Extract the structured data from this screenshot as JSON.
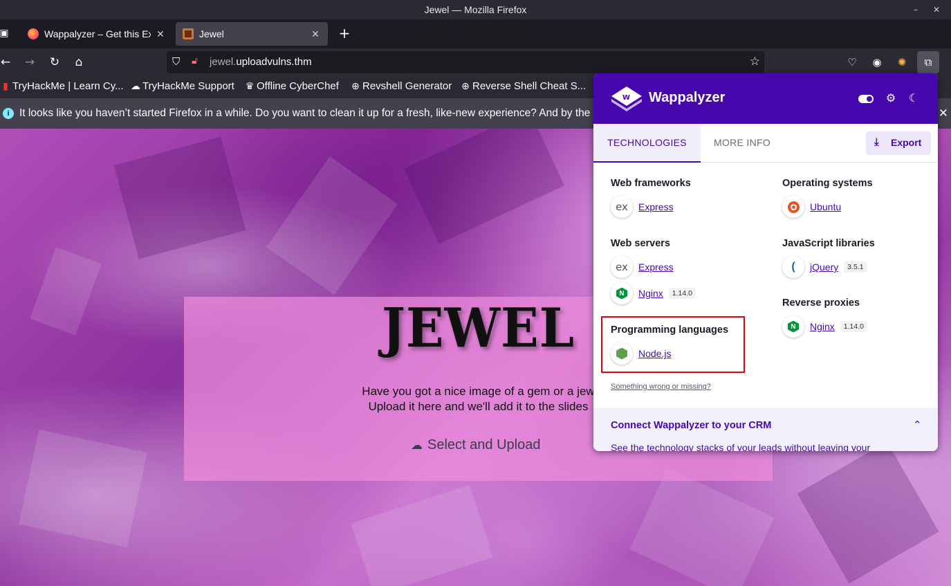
{
  "window": {
    "title": "Jewel — Mozilla Firefox"
  },
  "tabs": [
    {
      "label": "Wappalyzer – Get this Ext",
      "active": false
    },
    {
      "label": "Jewel",
      "active": true
    }
  ],
  "nav": {
    "url_prefix": "jewel.",
    "url_domain": "uploadvulns.thm"
  },
  "bookmarks": [
    {
      "label": "TryHackMe | Learn Cy..."
    },
    {
      "label": "TryHackMe Support"
    },
    {
      "label": "Offline CyberChef"
    },
    {
      "label": "Revshell Generator"
    },
    {
      "label": "Reverse Shell Cheat S..."
    }
  ],
  "notification": {
    "text": "It looks like you haven’t started Firefox in a while. Do you want to clean it up for a fresh, like-new experience? And by the way,"
  },
  "page": {
    "title": "JEWEL",
    "tagline_line1": "Have you got a nice image of a gem or a jew",
    "tagline_line2": "Upload it here and we'll add it to the slides",
    "upload_label": "Select and Upload"
  },
  "wappalyzer": {
    "brand": "Wappalyzer",
    "tabs": {
      "technologies": "TECHNOLOGIES",
      "more_info": "MORE INFO"
    },
    "export_label": "Export",
    "categories": {
      "web_frameworks": {
        "title": "Web frameworks",
        "items": [
          {
            "name": "Express",
            "icon": "express-icon"
          }
        ]
      },
      "web_servers": {
        "title": "Web servers",
        "items": [
          {
            "name": "Express",
            "icon": "express-icon"
          },
          {
            "name": "Nginx",
            "version": "1.14.0",
            "icon": "nginx-icon"
          }
        ]
      },
      "programming_languages": {
        "title": "Programming languages",
        "items": [
          {
            "name": "Node.js",
            "icon": "nodejs-icon"
          }
        ]
      },
      "operating_systems": {
        "title": "Operating systems",
        "items": [
          {
            "name": "Ubuntu",
            "icon": "ubuntu-icon"
          }
        ]
      },
      "javascript_libraries": {
        "title": "JavaScript libraries",
        "items": [
          {
            "name": "jQuery",
            "version": "3.5.1",
            "icon": "jquery-icon"
          }
        ]
      },
      "reverse_proxies": {
        "title": "Reverse proxies",
        "items": [
          {
            "name": "Nginx",
            "version": "1.14.0",
            "icon": "nginx-icon"
          }
        ]
      }
    },
    "wrong_link": "Something wrong or missing?",
    "crm": {
      "title": "Connect Wappalyzer to your CRM",
      "text": "See the technology stacks of your leads without leaving your"
    },
    "colors": {
      "brand": "#4608ad",
      "highlight": "#e0000a"
    }
  }
}
